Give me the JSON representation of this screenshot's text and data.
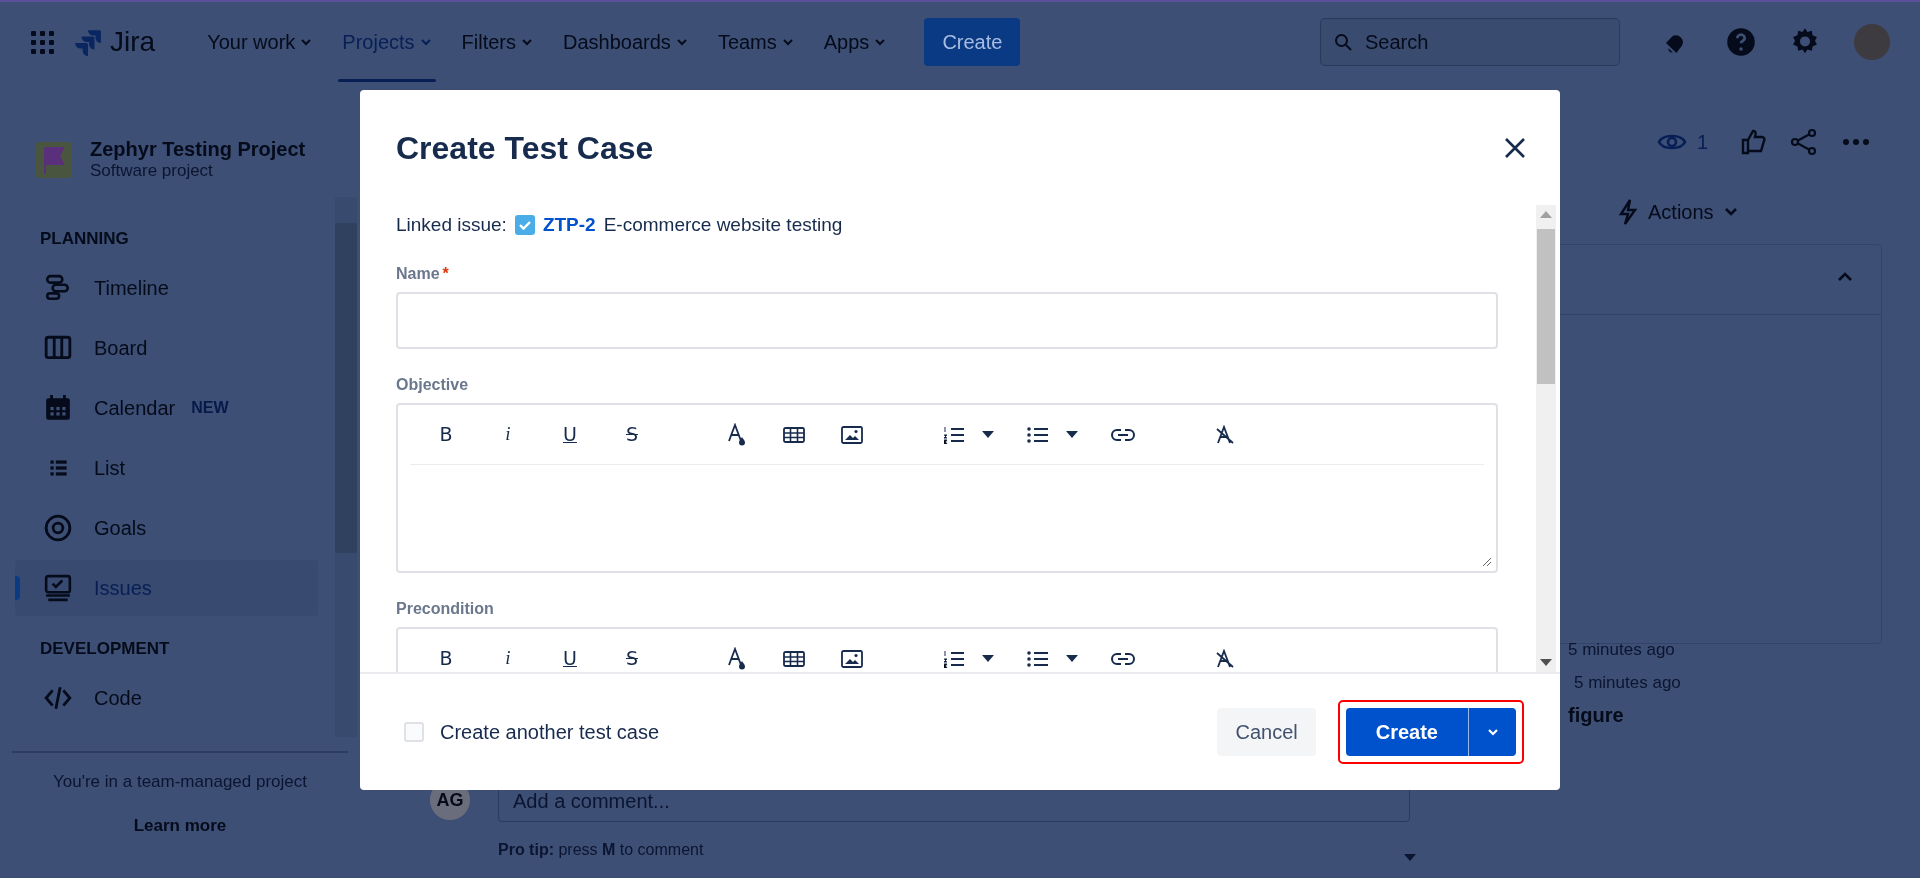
{
  "topbar": {
    "product": "Jira",
    "nav": [
      {
        "label": "Your work",
        "selected": false
      },
      {
        "label": "Projects",
        "selected": true
      },
      {
        "label": "Filters",
        "selected": false
      },
      {
        "label": "Dashboards",
        "selected": false
      },
      {
        "label": "Teams",
        "selected": false
      },
      {
        "label": "Apps",
        "selected": false
      }
    ],
    "create": "Create",
    "search": {
      "placeholder": "Search"
    }
  },
  "sidebar": {
    "project": {
      "name": "Zephyr Testing Project",
      "type": "Software project"
    },
    "sections": [
      {
        "title": "PLANNING",
        "items": [
          {
            "label": "Timeline",
            "kind": "timeline",
            "selected": false
          },
          {
            "label": "Board",
            "kind": "board",
            "selected": false
          },
          {
            "label": "Calendar",
            "kind": "calendar",
            "selected": false,
            "badge": "NEW"
          },
          {
            "label": "List",
            "kind": "list",
            "selected": false
          },
          {
            "label": "Goals",
            "kind": "goals",
            "selected": false
          },
          {
            "label": "Issues",
            "kind": "issues",
            "selected": true
          }
        ]
      },
      {
        "title": "DEVELOPMENT",
        "items": [
          {
            "label": "Code",
            "kind": "code",
            "selected": false
          }
        ]
      }
    ],
    "footer": {
      "text": "You're in a team-managed project",
      "link": "Learn more"
    }
  },
  "background": {
    "comment": {
      "avatar": "AG",
      "placeholder": "Add a comment...",
      "tip": "**Pro tip:** press **M** to comment"
    },
    "watchers": "1",
    "actions": "Actions",
    "activity": [
      "5 minutes ago",
      "5 minutes ago"
    ],
    "heading": "figure"
  },
  "dialog": {
    "title": "Create Test Case",
    "linked": {
      "label": "Linked issue:",
      "key": "ZTP-2",
      "summary": "E-commerce website testing"
    },
    "fields": [
      {
        "kind": "text",
        "label": "Name",
        "required_mark": "*"
      },
      {
        "kind": "editor",
        "label": "Objective",
        "resizable": true,
        "toolbar": [
          [
            {
              "kind": "bold",
              "label": "B"
            },
            {
              "kind": "italic",
              "label": "i"
            },
            {
              "kind": "underline",
              "label": "U"
            },
            {
              "kind": "strike",
              "label": "S"
            }
          ],
          [
            {
              "kind": "text-color"
            },
            {
              "kind": "table"
            },
            {
              "kind": "image"
            }
          ],
          [
            {
              "kind": "ordered-list"
            },
            {
              "kind": "menu-caret"
            },
            {
              "kind": "bullet-list"
            },
            {
              "kind": "menu-caret"
            },
            {
              "kind": "link"
            }
          ],
          [
            {
              "kind": "clear-format"
            }
          ]
        ]
      },
      {
        "kind": "editor",
        "label": "Precondition",
        "toolbar": [
          [
            {
              "kind": "bold",
              "label": "B"
            },
            {
              "kind": "italic",
              "label": "i"
            },
            {
              "kind": "underline",
              "label": "U"
            },
            {
              "kind": "strike",
              "label": "S"
            }
          ],
          [
            {
              "kind": "text-color"
            },
            {
              "kind": "table"
            },
            {
              "kind": "image"
            }
          ],
          [
            {
              "kind": "ordered-list"
            },
            {
              "kind": "menu-caret"
            },
            {
              "kind": "bullet-list"
            },
            {
              "kind": "menu-caret"
            },
            {
              "kind": "link"
            }
          ],
          [
            {
              "kind": "clear-format"
            }
          ]
        ]
      }
    ],
    "create_another": {
      "label": "Create another test case",
      "checked": false
    },
    "cancel": "Cancel",
    "submit": "Create",
    "highlighted": true
  }
}
